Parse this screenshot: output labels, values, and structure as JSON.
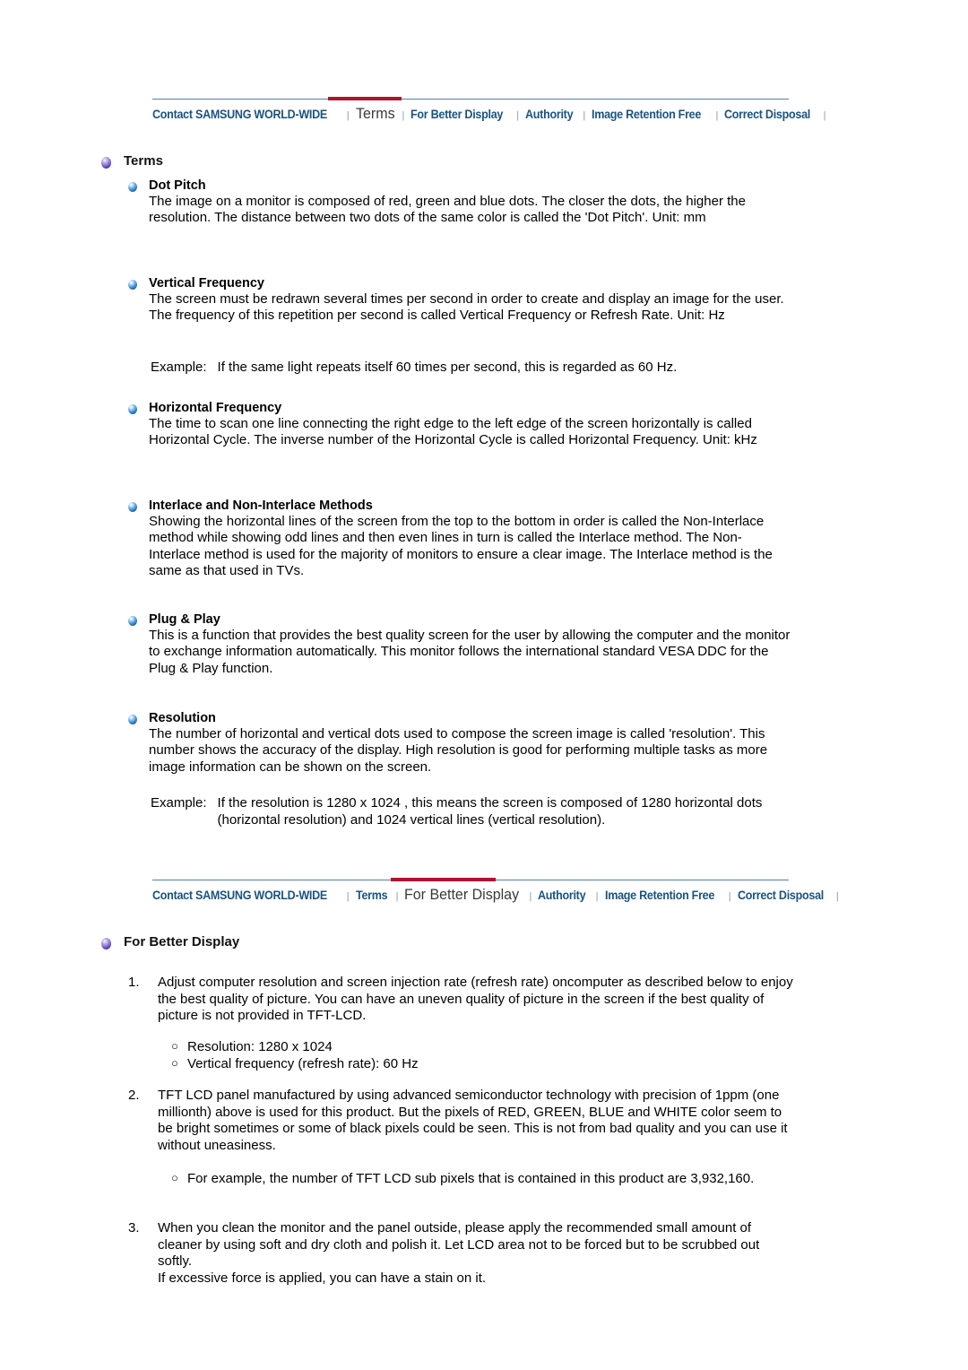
{
  "colors": {
    "nav_link": "#1a5380",
    "nav_active": "#3a3a3a",
    "accent_red": "#b3112c",
    "rule": "#5b7e9e"
  },
  "nav_top": {
    "active": "Terms",
    "items": [
      {
        "label": "Contact SAMSUNG WORLD-WIDE"
      },
      {
        "label": "Terms"
      },
      {
        "label": "For Better Display"
      },
      {
        "label": "Authority"
      },
      {
        "label": "Image Retention Free"
      },
      {
        "label": "Correct Disposal"
      }
    ]
  },
  "nav_bottom": {
    "active": "For Better Display",
    "items": [
      {
        "label": "Contact SAMSUNG WORLD-WIDE"
      },
      {
        "label": "Terms"
      },
      {
        "label": "For Better Display"
      },
      {
        "label": "Authority"
      },
      {
        "label": "Image Retention Free"
      },
      {
        "label": "Correct Disposal"
      }
    ]
  },
  "terms_section": {
    "heading": "Terms",
    "entries": [
      {
        "title": "Dot Pitch",
        "body": "The image on a monitor is composed of red, green and blue dots. The closer the dots, the higher the resolution. The distance between two dots of the same color is called the 'Dot Pitch'. Unit: mm"
      },
      {
        "title": "Vertical Frequency",
        "body": "The screen must be redrawn several times per second in order to create and display an image for the user. The frequency of this repetition per second is called Vertical Frequency or Refresh Rate. Unit: Hz"
      },
      {
        "title": "Horizontal Frequency",
        "body": "The time to scan one line connecting the right edge to the left edge of the screen horizontally is called Horizontal Cycle. The inverse number of the Horizontal Cycle is called Horizontal Frequency. Unit: kHz"
      },
      {
        "title": "Interlace and Non-Interlace Methods",
        "body": "Showing the horizontal lines of the screen from the top to the bottom in order is called the Non-Interlace method while showing odd lines and then even lines in turn is called the Interlace method. The Non-Interlace method is used for the majority of monitors to ensure a clear image. The Interlace method is the same as that used in TVs."
      },
      {
        "title": "Plug & Play",
        "body": "This is a function that provides the best quality screen for the user by allowing the computer and the monitor to exchange information automatically. This monitor follows the international standard VESA DDC for the Plug & Play function."
      },
      {
        "title": "Resolution",
        "body": "The number of horizontal and vertical dots used to compose the screen image is called 'resolution'. This number shows the accuracy of the display. High resolution is good for performing multiple tasks as more image information can be shown on the screen."
      }
    ],
    "example_vertical_frequency": {
      "label": "Example:",
      "text": "If the same light repeats itself 60 times per second, this is regarded as 60 Hz."
    },
    "example_resolution": {
      "label": "Example:",
      "text": "If the resolution is 1280 x 1024 , this means the screen is composed of 1280 horizontal dots (horizontal resolution) and 1024 vertical lines (vertical resolution)."
    }
  },
  "better_display_section": {
    "heading": "For Better Display",
    "items": [
      {
        "number": "1.",
        "text": "Adjust computer resolution and screen injection rate (refresh rate) oncomputer as described below to enjoy the best quality of picture. You can have an uneven quality of picture in the screen if the best quality of picture is not provided in TFT-LCD.",
        "sub": [
          "Resolution: 1280 x 1024",
          "Vertical frequency (refresh rate): 60 Hz"
        ]
      },
      {
        "number": "2.",
        "text": "TFT LCD panel manufactured by using advanced semiconductor technology with precision of 1ppm (one millionth) above is used for this product. But the pixels of RED, GREEN, BLUE and WHITE color seem to be bright sometimes or some of black pixels could be seen. This is not from bad quality and you can use it without uneasiness.",
        "sub": [
          "For example, the number of TFT LCD sub pixels that is contained in this product are 3,932,160."
        ]
      },
      {
        "number": "3.",
        "text": "When you clean the monitor and the panel outside, please apply the recommended small amount of cleaner by using soft and dry cloth and polish it. Let LCD area not to be forced but to be scrubbed out softly.\nIf excessive force is applied, you can have a stain on it.",
        "sub": []
      }
    ]
  },
  "bullet_dot": "○"
}
